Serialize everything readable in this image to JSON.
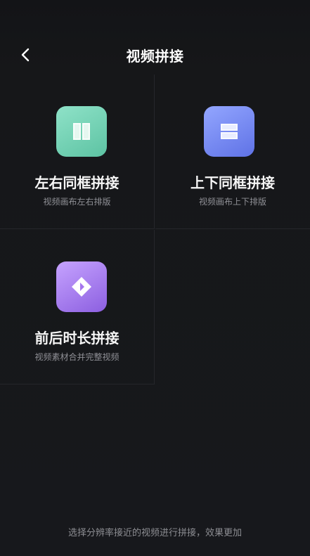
{
  "header": {
    "title": "视频拼接",
    "back_icon": "back-arrow-icon"
  },
  "options": [
    {
      "title": "左右同框拼接",
      "subtitle": "视频画布左右排版",
      "icon": "split-left-right-icon",
      "color": "#6fd1b2"
    },
    {
      "title": "上下同框拼接",
      "subtitle": "视频画布上下排版",
      "icon": "split-top-bottom-icon",
      "color": "#7486f2"
    },
    {
      "title": "前后时长拼接",
      "subtitle": "视频素材合并完整视频",
      "icon": "sequence-merge-icon",
      "color": "#a675ee"
    }
  ],
  "footer": {
    "note": "选择分辨率接近的视频进行拼接，效果更加"
  }
}
